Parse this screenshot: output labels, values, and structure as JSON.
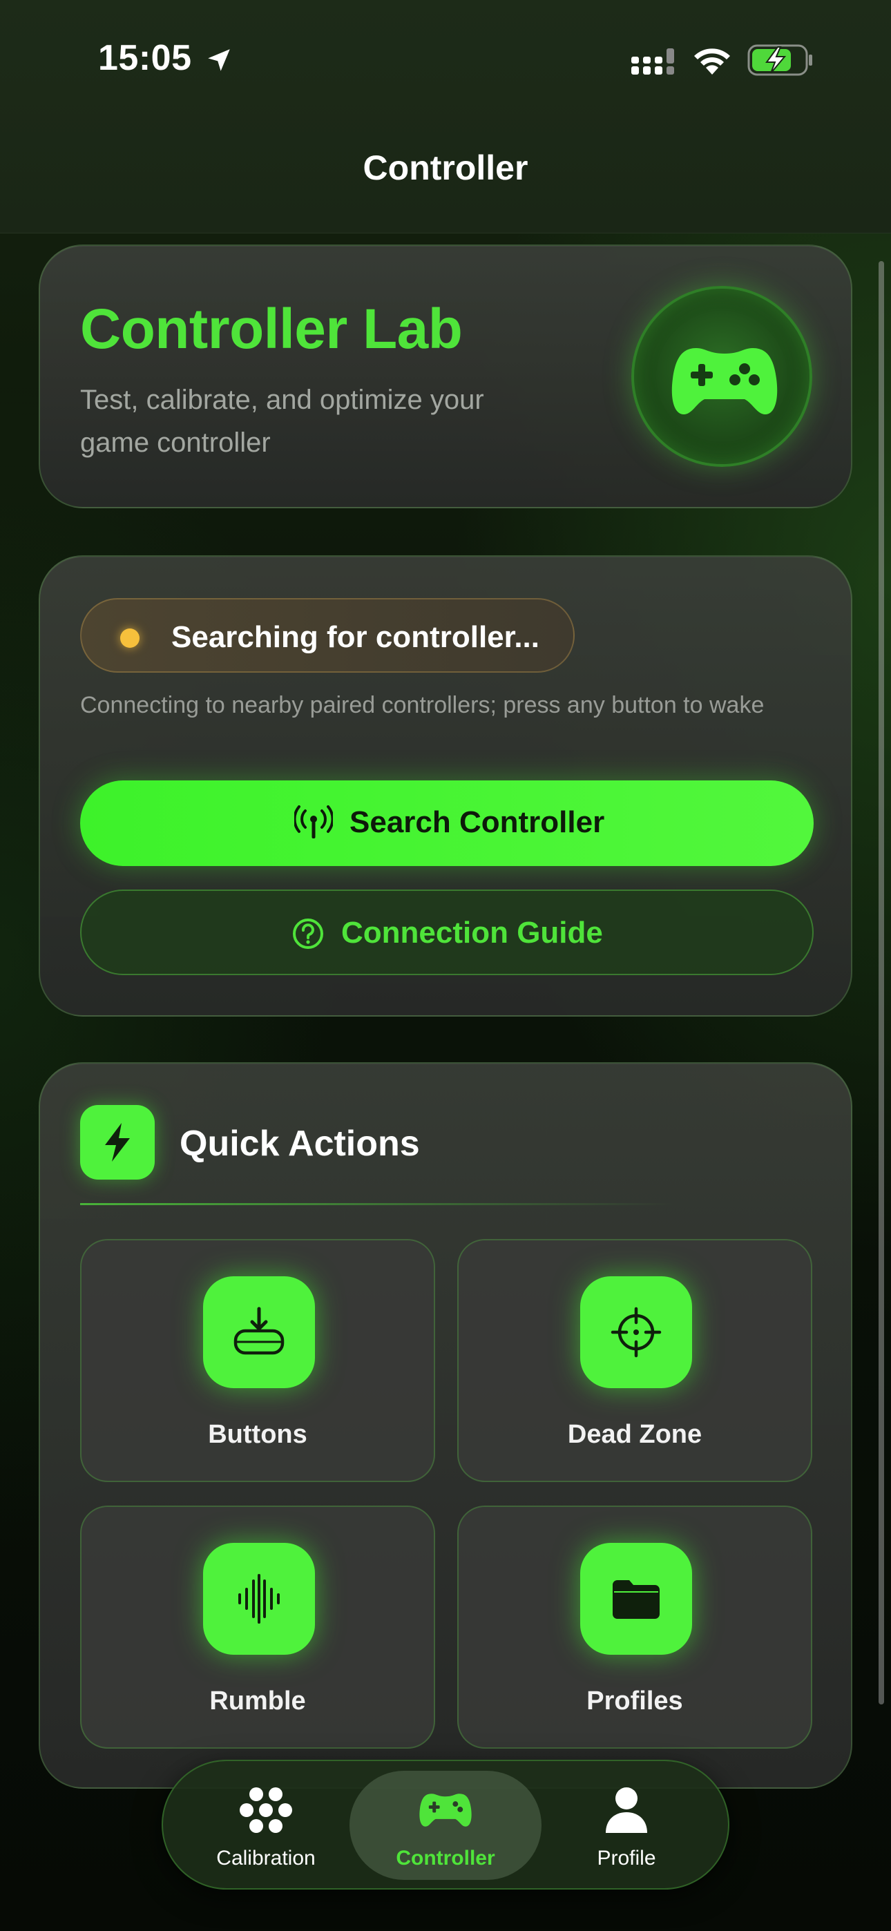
{
  "status_bar": {
    "time": "15:05"
  },
  "header": {
    "title": "Controller"
  },
  "hero": {
    "title": "Controller Lab",
    "subtitle": "Test, calibrate, and optimize your game controller"
  },
  "connection": {
    "status": "Searching for controller...",
    "helper": "Connecting to nearby paired controllers; press any button to wake",
    "primary_button": "Search Controller",
    "secondary_button": "Connection Guide"
  },
  "quick_actions": {
    "title": "Quick Actions",
    "tiles": [
      {
        "label": "Buttons",
        "icon": "button-press-icon"
      },
      {
        "label": "Dead Zone",
        "icon": "crosshair-icon"
      },
      {
        "label": "Rumble",
        "icon": "waveform-icon"
      },
      {
        "label": "Profiles",
        "icon": "folder-icon"
      }
    ]
  },
  "tabbar": {
    "items": [
      {
        "label": "Calibration",
        "icon": "dots-cluster-icon",
        "active": false
      },
      {
        "label": "Controller",
        "icon": "gamepad-icon",
        "active": true
      },
      {
        "label": "Profile",
        "icon": "person-icon",
        "active": false
      }
    ]
  },
  "colors": {
    "accent": "#4fe43a",
    "status_warning": "#f6c03c",
    "card_bg": "#2e302d"
  }
}
